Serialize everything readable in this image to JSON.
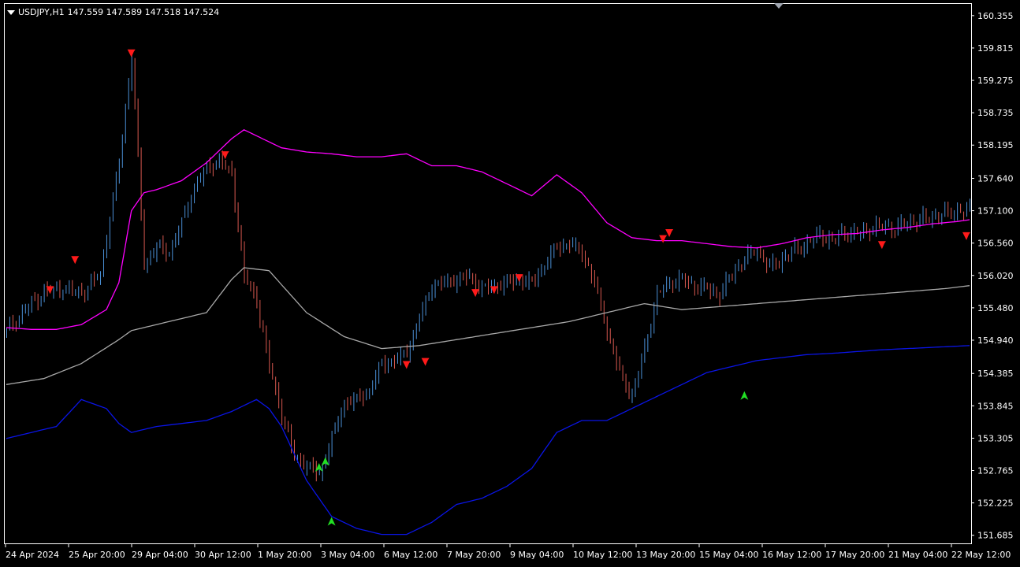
{
  "header": {
    "symbol_line": "USDJPY,H1",
    "ohlc": "147.559 147.589 147.518 147.524"
  },
  "colors": {
    "background": "#000000",
    "axis": "#ffffff",
    "candle_up": "#4a8fd6",
    "candle_down": "#d8584f",
    "upper_band": "#ff00ff",
    "middle_band": "#a8a8a8",
    "lower_band": "#0a14e6",
    "sell_arrow": "#ff1a1a",
    "buy_arrow": "#22e024"
  },
  "icons": {
    "menu": "triangle-down-icon",
    "chart_shift": "shift-triangle-icon",
    "sell_signal": "red-arrow-down-icon",
    "buy_signal": "green-arrow-up-icon"
  },
  "chart_data": {
    "type": "line",
    "symbol": "USDJPY",
    "timeframe": "H1",
    "title": "USDJPY,H1",
    "grid": false,
    "xlabel": "",
    "ylabel": "",
    "ylim": [
      151.55,
      160.55
    ],
    "y_ticks": [
      "160.355",
      "159.815",
      "159.275",
      "158.735",
      "158.195",
      "157.640",
      "157.100",
      "156.560",
      "156.020",
      "155.480",
      "154.940",
      "154.385",
      "153.845",
      "153.305",
      "152.765",
      "152.225",
      "151.685"
    ],
    "x_ticks": [
      "24 Apr 2024",
      "25 Apr 20:00",
      "29 Apr 04:00",
      "30 Apr 12:00",
      "1 May 20:00",
      "3 May 04:00",
      "6 May 12:00",
      "7 May 20:00",
      "9 May 04:00",
      "10 May 12:00",
      "13 May 20:00",
      "15 May 04:00",
      "16 May 12:00",
      "17 May 20:00",
      "21 May 04:00",
      "22 May 12:00"
    ],
    "close_series": {
      "name": "",
      "x": [
        0,
        6,
        12,
        18,
        24,
        30,
        36,
        40,
        44,
        48,
        52,
        56,
        60,
        64,
        68,
        72,
        76,
        80,
        84,
        88,
        92,
        96,
        100,
        104,
        108,
        112,
        116,
        120,
        124,
        128,
        132,
        136,
        140,
        144,
        148,
        152,
        156,
        160,
        164,
        168,
        172,
        176,
        180,
        184,
        188,
        192,
        196,
        200,
        204,
        208,
        212,
        216,
        220,
        224,
        228,
        232,
        236,
        240,
        244,
        248,
        252,
        256,
        260,
        264,
        268,
        272,
        276,
        280,
        284,
        288,
        292,
        296,
        300,
        304,
        308
      ],
      "close": [
        155.1,
        155.45,
        155.75,
        155.8,
        155.72,
        156.05,
        157.9,
        159.7,
        156.2,
        156.5,
        156.4,
        156.9,
        157.5,
        157.8,
        157.95,
        157.7,
        156.0,
        155.6,
        154.5,
        153.7,
        153.0,
        152.85,
        152.7,
        153.3,
        153.9,
        153.95,
        154.1,
        154.55,
        154.6,
        154.75,
        155.3,
        155.85,
        155.9,
        155.95,
        156.0,
        155.8,
        155.85,
        155.9,
        155.95,
        155.9,
        156.2,
        156.5,
        156.55,
        156.4,
        155.9,
        155.1,
        154.4,
        154.0,
        154.8,
        155.7,
        155.9,
        155.95,
        155.85,
        155.8,
        155.7,
        156.05,
        156.3,
        156.45,
        156.15,
        156.3,
        156.45,
        156.55,
        156.7,
        156.6,
        156.75,
        156.7,
        156.8,
        156.85,
        156.8,
        156.9,
        156.95,
        157.0,
        157.05,
        157.1,
        157.1
      ]
    },
    "series": [
      {
        "name": "",
        "x": [
          0,
          8,
          16,
          24,
          32,
          36,
          40,
          44,
          48,
          56,
          64,
          72,
          76,
          80,
          84,
          88,
          96,
          104,
          112,
          120,
          128,
          136,
          144,
          152,
          160,
          168,
          176,
          184,
          192,
          200,
          208,
          216,
          224,
          232,
          240,
          248,
          256,
          264,
          272,
          280,
          288,
          296,
          304,
          308
        ],
        "values": [
          155.15,
          155.12,
          155.12,
          155.2,
          155.45,
          155.9,
          157.1,
          157.4,
          157.45,
          157.6,
          157.9,
          158.3,
          158.45,
          158.35,
          158.25,
          158.15,
          158.08,
          158.05,
          158.0,
          158.0,
          158.05,
          157.85,
          157.85,
          157.75,
          157.55,
          157.35,
          157.7,
          157.4,
          156.9,
          156.65,
          156.6,
          156.6,
          156.55,
          156.5,
          156.48,
          156.55,
          156.65,
          156.7,
          156.72,
          156.78,
          156.82,
          156.88,
          156.92,
          156.95
        ]
      },
      {
        "name": "",
        "x": [
          0,
          12,
          24,
          36,
          40,
          44,
          52,
          64,
          72,
          76,
          84,
          96,
          108,
          120,
          132,
          144,
          156,
          168,
          180,
          192,
          204,
          216,
          228,
          240,
          252,
          264,
          276,
          288,
          300,
          308
        ],
        "values": [
          154.2,
          154.3,
          154.55,
          154.95,
          155.1,
          155.15,
          155.25,
          155.4,
          155.95,
          156.15,
          156.1,
          155.4,
          155.0,
          154.8,
          154.85,
          154.95,
          155.05,
          155.15,
          155.25,
          155.4,
          155.55,
          155.45,
          155.5,
          155.55,
          155.6,
          155.65,
          155.7,
          155.75,
          155.8,
          155.85
        ]
      },
      {
        "name": "",
        "x": [
          0,
          8,
          16,
          24,
          32,
          36,
          40,
          44,
          48,
          56,
          64,
          72,
          76,
          80,
          84,
          88,
          96,
          104,
          112,
          120,
          128,
          136,
          144,
          152,
          160,
          168,
          176,
          184,
          192,
          200,
          208,
          216,
          224,
          232,
          240,
          248,
          256,
          264,
          272,
          280,
          288,
          296,
          304,
          308
        ],
        "values": [
          153.3,
          153.4,
          153.5,
          153.95,
          153.8,
          153.55,
          153.4,
          153.45,
          153.5,
          153.55,
          153.6,
          153.75,
          153.85,
          153.95,
          153.8,
          153.5,
          152.6,
          152.0,
          151.8,
          151.7,
          151.7,
          151.9,
          152.2,
          152.3,
          152.5,
          152.8,
          153.4,
          153.6,
          153.6,
          153.8,
          154.0,
          154.2,
          154.4,
          154.5,
          154.6,
          154.65,
          154.7,
          154.72,
          154.75,
          154.78,
          154.8,
          154.82,
          154.84,
          154.85
        ]
      }
    ],
    "sell_signals": [
      {
        "x": 14,
        "y": 155.75
      },
      {
        "x": 22,
        "y": 156.25
      },
      {
        "x": 40,
        "y": 159.7
      },
      {
        "x": 70,
        "y": 158.0
      },
      {
        "x": 128,
        "y": 154.5
      },
      {
        "x": 134,
        "y": 154.55
      },
      {
        "x": 150,
        "y": 155.7
      },
      {
        "x": 156,
        "y": 155.75
      },
      {
        "x": 164,
        "y": 155.95
      },
      {
        "x": 210,
        "y": 156.6
      },
      {
        "x": 212,
        "y": 156.7
      },
      {
        "x": 280,
        "y": 156.5
      },
      {
        "x": 307,
        "y": 156.65
      }
    ],
    "buy_signals": [
      {
        "x": 100,
        "y": 152.85
      },
      {
        "x": 102,
        "y": 152.95
      },
      {
        "x": 104,
        "y": 151.95
      },
      {
        "x": 236,
        "y": 154.05
      }
    ]
  }
}
